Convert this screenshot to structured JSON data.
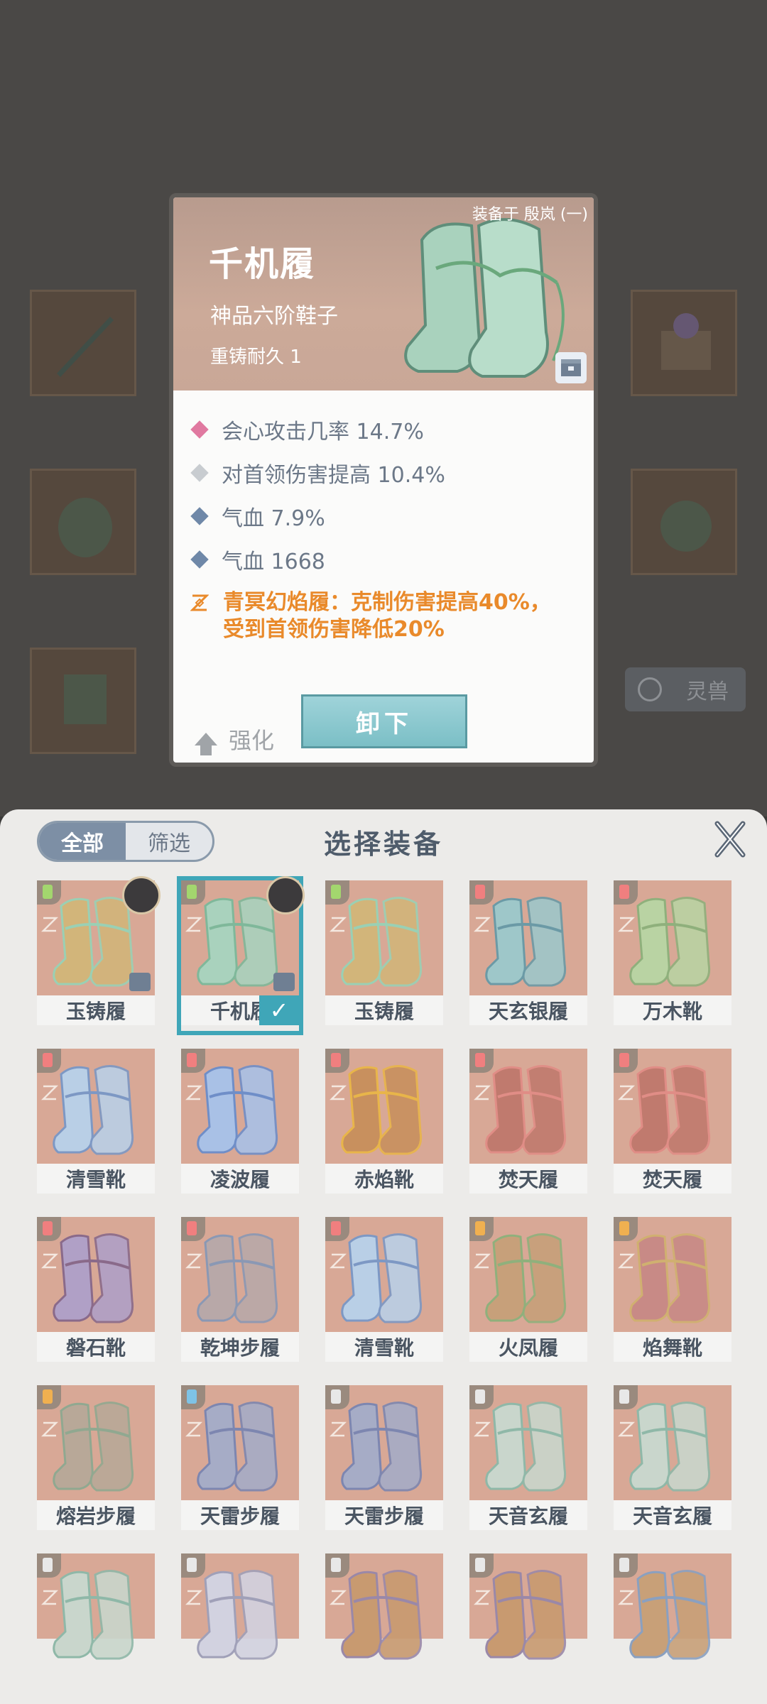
{
  "background": {
    "pet_button_label": "灵兽"
  },
  "detail": {
    "equipped_on": "装备于 殷岚 (一)",
    "name": "千机履",
    "grade": "神品六阶鞋子",
    "durability": "重铸耐久 1",
    "stats": [
      {
        "text": "会心攻击几率 14.7%",
        "color": "#e079a0"
      },
      {
        "text": "对首领伤害提高 10.4%",
        "color": "#c8ccd0"
      },
      {
        "text": "气血 7.9%",
        "color": "#6f88a8"
      },
      {
        "text": "气血 1668",
        "color": "#6f88a8"
      }
    ],
    "set_bonus_line1": "青冥幻焰履：克制伤害提高40%，",
    "set_bonus_line2": "受到首领伤害降低20%",
    "upgrade_label": "强化",
    "unequip_label": "卸下"
  },
  "panel": {
    "title": "选择装备",
    "segment_all": "全部",
    "segment_filter": "筛选",
    "items": [
      {
        "label": "玉铸履",
        "tier": "#a3d66e",
        "boot": "#d2b57a",
        "accent": "#9ad0b4"
      },
      {
        "label": "千机履",
        "tier": "#a3d66e",
        "boot": "#a9d2bd",
        "accent": "#7fb89a"
      },
      {
        "label": "玉铸履",
        "tier": "#a3d66e",
        "boot": "#d2b57a",
        "accent": "#9ad0b4"
      },
      {
        "label": "天玄银履",
        "tier": "#f07f7f",
        "boot": "#9ec7c9",
        "accent": "#6b9aa6"
      },
      {
        "label": "万木靴",
        "tier": "#f07f7f",
        "boot": "#b9d3a3",
        "accent": "#8fb07c"
      },
      {
        "label": "清雪靴",
        "tier": "#f07f7f",
        "boot": "#b9cfe6",
        "accent": "#7d98c4"
      },
      {
        "label": "凌波履",
        "tier": "#f07f7f",
        "boot": "#a9c1e6",
        "accent": "#6f8ec8"
      },
      {
        "label": "赤焰靴",
        "tier": "#f07f7f",
        "boot": "#c8905e",
        "accent": "#e8b54a"
      },
      {
        "label": "焚天履",
        "tier": "#f07f7f",
        "boot": "#c07a6e",
        "accent": "#e08d86"
      },
      {
        "label": "焚天履",
        "tier": "#f07f7f",
        "boot": "#c07a6e",
        "accent": "#e08d86"
      },
      {
        "label": "磐石靴",
        "tier": "#f07f7f",
        "boot": "#b0a0c6",
        "accent": "#8a6a8a"
      },
      {
        "label": "乾坤步履",
        "tier": "#f07f7f",
        "boot": "#b8a8a8",
        "accent": "#8a98b4"
      },
      {
        "label": "清雪靴",
        "tier": "#f07f7f",
        "boot": "#b9cfe6",
        "accent": "#7d98c4"
      },
      {
        "label": "火凤履",
        "tier": "#f0b050",
        "boot": "#c7a07a",
        "accent": "#8fb07c"
      },
      {
        "label": "焰舞靴",
        "tier": "#f0b050",
        "boot": "#c88a86",
        "accent": "#d0b070"
      },
      {
        "label": "熔岩步履",
        "tier": "#f0b050",
        "boot": "#b8a898",
        "accent": "#90a890"
      },
      {
        "label": "天雷步履",
        "tier": "#7ec3e6",
        "boot": "#a6acc6",
        "accent": "#7d86b0"
      },
      {
        "label": "天雷步履",
        "tier": "#e8e8e8",
        "boot": "#a6acc6",
        "accent": "#7d86b0"
      },
      {
        "label": "天音玄履",
        "tier": "#e8e8e8",
        "boot": "#c9d6cc",
        "accent": "#8fb8a8"
      },
      {
        "label": "天音玄履",
        "tier": "#e8e8e8",
        "boot": "#c9d6cc",
        "accent": "#8fb8a8"
      },
      {
        "label": "",
        "tier": "#e8e8e8",
        "boot": "#c9d6cc",
        "accent": "#8fb8a8"
      },
      {
        "label": "",
        "tier": "#e8e8e8",
        "boot": "#d2d2e0",
        "accent": "#a0a0b8"
      },
      {
        "label": "",
        "tier": "#e8e8e8",
        "boot": "#c89a70",
        "accent": "#9a88a8"
      },
      {
        "label": "",
        "tier": "#e8e8e8",
        "boot": "#c89a70",
        "accent": "#9a88a8"
      },
      {
        "label": "",
        "tier": "#e8e8e8",
        "boot": "#c8a078",
        "accent": "#8aa0c0"
      }
    ]
  }
}
